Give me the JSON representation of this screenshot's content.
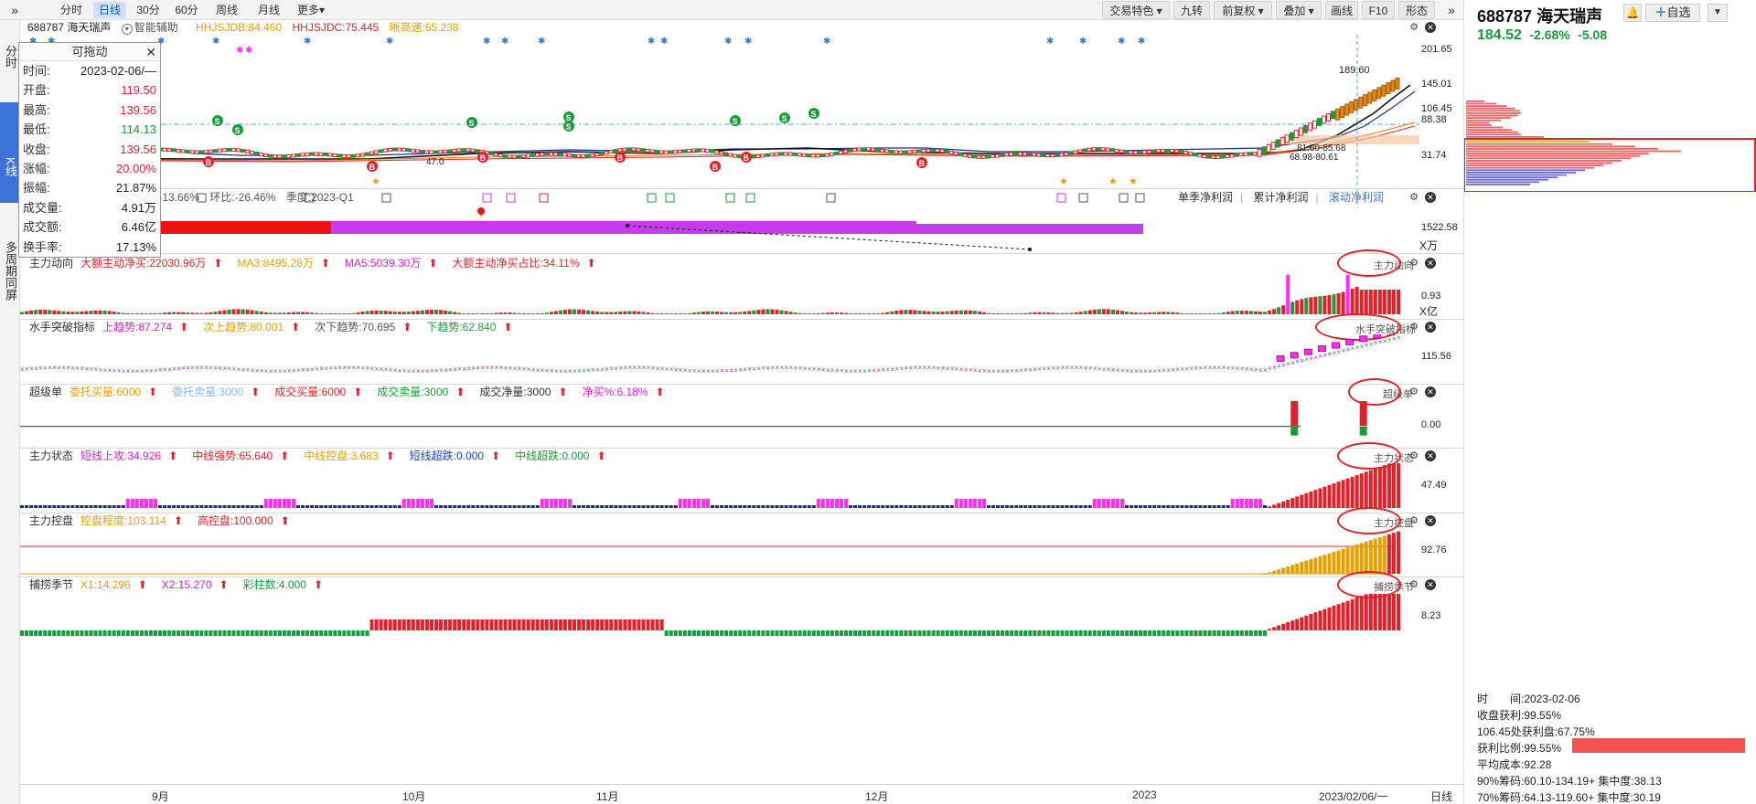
{
  "toolbar": {
    "expand": "»",
    "periods": [
      "分时",
      "日线",
      "30分",
      "60分",
      "周线",
      "月线",
      "更多▾"
    ],
    "active_period": "日线",
    "right_buttons": [
      "交易特色 ▾",
      "九转",
      "前复权 ▾",
      "叠加 ▾",
      "画线",
      "F10",
      "形态"
    ]
  },
  "left_tabs": [
    "分时",
    "K线",
    "多周期同屏"
  ],
  "kline": {
    "stock_label": "688787 海天瑞声",
    "assist": "智能辅助",
    "indicators": [
      "HHJSJDB:84.460",
      "HHJSJDC:75.445",
      "晰高速:65.238"
    ],
    "indicator_colors": [
      "#e6a000",
      "#e0232b",
      "#e6a000"
    ],
    "price_labels": [
      "201.65",
      "145.01",
      "106.45",
      "88.38",
      "31.74"
    ],
    "annotations": [
      "189.60",
      "81.60-85.68",
      "68.98-80.61",
      "47.0"
    ]
  },
  "infobox": {
    "title": "可拖动",
    "rows": [
      {
        "k": "时间:",
        "v": "2023-02-06/—",
        "c": "#222"
      },
      {
        "k": "开盘:",
        "v": "119.50",
        "c": "#e0232b"
      },
      {
        "k": "最高:",
        "v": "139.56",
        "c": "#e0232b"
      },
      {
        "k": "最低:",
        "v": "114.13",
        "c": "#1a9a3b"
      },
      {
        "k": "收盘:",
        "v": "139.56",
        "c": "#e0232b"
      },
      {
        "k": "涨幅:",
        "v": "20.00%",
        "c": "#e0232b"
      },
      {
        "k": "振幅:",
        "v": "21.87%",
        "c": "#222"
      },
      {
        "k": "成交量:",
        "v": "4.91万",
        "c": "#222"
      },
      {
        "k": "成交额:",
        "v": "6.46亿",
        "c": "#222"
      },
      {
        "k": "换手率:",
        "v": "17.13%",
        "c": "#222"
      }
    ]
  },
  "profit_panel": {
    "text": [
      "同比:-13.66%",
      "环比:-26.46%",
      "季度:2023-Q1"
    ],
    "tabs": [
      "单季净利润",
      "累计净利润",
      "滚动净利润"
    ],
    "axis_value": "1522.58",
    "unit": "X万"
  },
  "panels": [
    {
      "id": "zhuli-dongxiang",
      "name": "主力动向",
      "items": [
        {
          "t": "大额主动净买:22030.96万",
          "c": "#e0232b"
        },
        {
          "t": "MA3:8495.28万",
          "c": "#e6a000"
        },
        {
          "t": "MA5:5039.30万",
          "c": "#d61fd0"
        },
        {
          "t": "大额主动净买占比:34.11%",
          "c": "#e0232b"
        }
      ],
      "axis": "0.93",
      "unit": "X亿",
      "btn": "主力动向"
    },
    {
      "id": "shuishou",
      "name": "水手突破指标",
      "items": [
        {
          "t": "上趋势:87.274",
          "c": "#d61fd0"
        },
        {
          "t": "次上趋势:80.001",
          "c": "#e6a000"
        },
        {
          "t": "次下趋势:70.695",
          "c": "#555"
        },
        {
          "t": "下趋势:62.840",
          "c": "#1a9a3b"
        }
      ],
      "axis": "115.56",
      "btn": "水手突破指标"
    },
    {
      "id": "chaojidan",
      "name": "超级单",
      "items": [
        {
          "t": "委托买量:6000",
          "c": "#e6a000"
        },
        {
          "t": "委托卖量:3000",
          "c": "#8fb8e6"
        },
        {
          "t": "成交买量:6000",
          "c": "#e0232b"
        },
        {
          "t": "成交卖量:3000",
          "c": "#1a9a3b"
        },
        {
          "t": "成交净量:3000",
          "c": "#333"
        },
        {
          "t": "净买%:6.18%",
          "c": "#d61fd0"
        }
      ],
      "axis": "0.00",
      "btn": "超级单"
    },
    {
      "id": "zhuli-zhuangtai",
      "name": "主力状态",
      "items": [
        {
          "t": "短线上攻:34.926",
          "c": "#d61fd0"
        },
        {
          "t": "中线强势:65.640",
          "c": "#e0232b"
        },
        {
          "t": "中线控盘:3.683",
          "c": "#e6a000"
        },
        {
          "t": "短线超跌:0.000",
          "c": "#1a3fd0"
        },
        {
          "t": "中线超跌:0.000",
          "c": "#1a9a3b"
        }
      ],
      "axis": "47.49",
      "btn": "主力状态"
    },
    {
      "id": "zhuli-kongpan",
      "name": "主力控盘",
      "items": [
        {
          "t": "控盘程度:103.114",
          "c": "#e6a000"
        },
        {
          "t": "高控盘:100.000",
          "c": "#e0232b"
        }
      ],
      "axis": "92.76",
      "btn": "主力控盘"
    },
    {
      "id": "bulao",
      "name": "捕捞季节",
      "items": [
        {
          "t": "X1:14.296",
          "c": "#e6a000"
        },
        {
          "t": "X2:15.270",
          "c": "#d61fd0"
        },
        {
          "t": "彩柱数:4.000",
          "c": "#1a9a3b"
        }
      ],
      "axis": "8.23",
      "btn": "捕捞季节"
    }
  ],
  "time_axis": {
    "labels": [
      "9月",
      "10月",
      "11月",
      "12月",
      "2023",
      "2023/02/06/一"
    ],
    "period_btn": "日线"
  },
  "right": {
    "code": "688787",
    "name": "海天瑞声",
    "price": "184.52",
    "change_pct": "-2.68%",
    "change": "-5.08",
    "add_btn": "自选",
    "chip_stats": [
      "时　　间:2023-02-06",
      "收盘获利:99.55%",
      "106.45处获利盘:67.75%",
      "获利比例:99.55%",
      "平均成本:92.28",
      "90%筹码:60.10-134.19+ 集中度:38.13",
      "70%筹码:64.13-119.60+ 集中度:30.19"
    ],
    "profit_ratio": 0.9955
  },
  "colors": {
    "up": "#e0232b",
    "down": "#1a9a3b",
    "accent": "#3b73d8",
    "magenta": "#d61fd0",
    "orange": "#e6a000"
  }
}
